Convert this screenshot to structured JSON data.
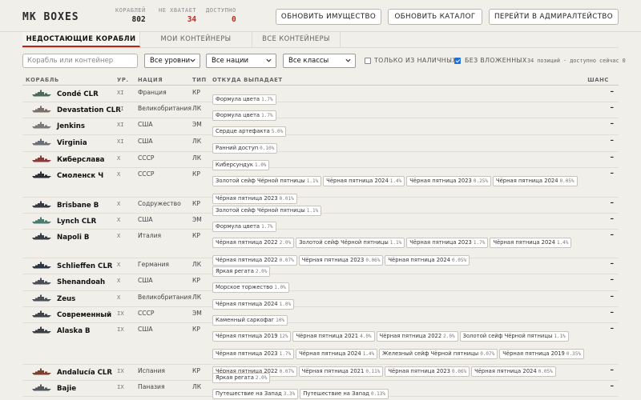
{
  "app": {
    "title": "MK BOXES"
  },
  "stats": [
    {
      "label": "КОРАБЛЕЙ",
      "value": "802",
      "color": "#222222"
    },
    {
      "label": "НЕ ХВАТАЕТ",
      "value": "34",
      "color": "#c0291f"
    },
    {
      "label": "ДОСТУПНО",
      "value": "0",
      "color": "#c0291f"
    }
  ],
  "header_buttons": [
    {
      "label": "ОБНОВИТЬ ИМУЩЕСТВО"
    },
    {
      "label": "ОБНОВИТЬ КАТАЛОГ"
    },
    {
      "label": "ПЕРЕЙТИ В АДМИРАЛТЕЙСТВО"
    }
  ],
  "tabs": [
    {
      "label": "НЕДОСТАЮЩИЕ КОРАБЛИ",
      "active": true
    },
    {
      "label": "МОИ КОНТЕЙНЕРЫ",
      "active": false
    },
    {
      "label": "ВСЕ КОНТЕЙНЕРЫ",
      "active": false
    }
  ],
  "filters": {
    "search_placeholder": "Корабль или контейнер",
    "tier_select": "Все уровни",
    "nation_select": "Все нации",
    "class_select": "Все классы",
    "only_available": {
      "label": "ТОЛЬКО ИЗ НАЛИЧНЫХ",
      "checked": false
    },
    "no_nested": {
      "label": "БЕЗ ВЛОЖЕННЫХ",
      "checked": true
    },
    "count_text": "34 позиций · доступно сейчас 0"
  },
  "table": {
    "headers": {
      "ship": "КОРАБЛЬ",
      "tier": "УР.",
      "nation": "НАЦИЯ",
      "type": "ТИП",
      "source": "ОТКУДА ВЫПАДАЕТ",
      "chance": "ШАНС"
    },
    "rows": [
      {
        "name": "Condé CLR",
        "tier": "XI",
        "nation": "Франция",
        "type": "КР",
        "chance": "–",
        "drops": [
          {
            "name": "Формула цвета",
            "pct": "1.7%"
          }
        ]
      },
      {
        "name": "Devastation CLR",
        "tier": "XI",
        "nation": "Великобритания",
        "type": "ЛК",
        "chance": "–",
        "drops": [
          {
            "name": "Формула цвета",
            "pct": "1.7%"
          }
        ]
      },
      {
        "name": "Jenkins",
        "tier": "XI",
        "nation": "США",
        "type": "ЭМ",
        "chance": "–",
        "drops": [
          {
            "name": "Сердце артефакта",
            "pct": "5.0%"
          }
        ]
      },
      {
        "name": "Virginia",
        "tier": "XI",
        "nation": "США",
        "type": "ЛК",
        "chance": "–",
        "drops": [
          {
            "name": "Ранний доступ",
            "pct": "0.10%"
          }
        ]
      },
      {
        "name": "Киберслава",
        "tier": "X",
        "nation": "СССР",
        "type": "ЛК",
        "chance": "–",
        "drops": [
          {
            "name": "Киберсундук",
            "pct": "1.0%"
          }
        ]
      },
      {
        "name": "Смоленск Ч",
        "tier": "X",
        "nation": "СССР",
        "type": "КР",
        "chance": "–",
        "drops": [
          {
            "name": "Золотой сейф Чёрной пятницы",
            "pct": "1.1%"
          },
          {
            "name": "Чёрная пятница 2024",
            "pct": "1.4%"
          },
          {
            "name": "Чёрная пятница 2023",
            "pct": "0.25%"
          },
          {
            "name": "Чёрная пятница 2024",
            "pct": "0.05%"
          },
          {
            "name": "Чёрная пятница 2023",
            "pct": "0.01%"
          }
        ]
      },
      {
        "name": "Brisbane B",
        "tier": "X",
        "nation": "Содружество",
        "type": "КР",
        "chance": "–",
        "drops": [
          {
            "name": "Золотой сейф Чёрной пятницы",
            "pct": "1.1%"
          }
        ]
      },
      {
        "name": "Lynch CLR",
        "tier": "X",
        "nation": "США",
        "type": "ЭМ",
        "chance": "–",
        "drops": [
          {
            "name": "Формула цвета",
            "pct": "1.7%"
          }
        ]
      },
      {
        "name": "Napoli B",
        "tier": "X",
        "nation": "Италия",
        "type": "КР",
        "chance": "–",
        "drops": [
          {
            "name": "Чёрная пятница 2022",
            "pct": "2.0%"
          },
          {
            "name": "Золотой сейф Чёрной пятницы",
            "pct": "1.1%"
          },
          {
            "name": "Чёрная пятница 2023",
            "pct": "1.7%"
          },
          {
            "name": "Чёрная пятница 2024",
            "pct": "1.4%"
          },
          {
            "name": "Чёрная пятница 2022",
            "pct": "0.07%"
          },
          {
            "name": "Чёрная пятница 2023",
            "pct": "0.06%"
          },
          {
            "name": "Чёрная пятница 2024",
            "pct": "0.05%"
          }
        ]
      },
      {
        "name": "Schlieffen CLR",
        "tier": "X",
        "nation": "Германия",
        "type": "ЛК",
        "chance": "–",
        "drops": [
          {
            "name": "Яркая регата",
            "pct": "2.0%"
          }
        ]
      },
      {
        "name": "Shenandoah",
        "tier": "X",
        "nation": "США",
        "type": "КР",
        "chance": "–",
        "drops": [
          {
            "name": "Морское торжество",
            "pct": "1.0%"
          }
        ]
      },
      {
        "name": "Zeus",
        "tier": "X",
        "nation": "Великобритания",
        "type": "ЛК",
        "chance": "–",
        "drops": [
          {
            "name": "Чёрная пятница 2024",
            "pct": "1.0%"
          }
        ]
      },
      {
        "name": "Современный",
        "tier": "IX",
        "nation": "СССР",
        "type": "ЭМ",
        "chance": "–",
        "drops": [
          {
            "name": "Каменный саркофаг",
            "pct": "10%"
          }
        ]
      },
      {
        "name": "Alaska B",
        "tier": "IX",
        "nation": "США",
        "type": "КР",
        "chance": "–",
        "drops": [
          {
            "name": "Чёрная пятница 2019",
            "pct": "12%"
          },
          {
            "name": "Чёрная пятница 2021",
            "pct": "4.0%"
          },
          {
            "name": "Чёрная пятница 2022",
            "pct": "2.0%"
          },
          {
            "name": "Золотой сейф Чёрной пятницы",
            "pct": "1.1%"
          },
          {
            "name": "Чёрная пятница 2023",
            "pct": "1.7%"
          },
          {
            "name": "Чёрная пятница 2024",
            "pct": "1.4%"
          },
          {
            "name": "Железный сейф Чёрной пятницы",
            "pct": "0.07%"
          },
          {
            "name": "Чёрная пятница 2019",
            "pct": "0.35%"
          },
          {
            "name": "Чёрная пятница 2022",
            "pct": "0.07%"
          },
          {
            "name": "Чёрная пятница 2021",
            "pct": "0.11%"
          },
          {
            "name": "Чёрная пятница 2023",
            "pct": "0.06%"
          },
          {
            "name": "Чёрная пятница 2024",
            "pct": "0.05%"
          }
        ]
      },
      {
        "name": "Andalucía CLR",
        "tier": "IX",
        "nation": "Испания",
        "type": "КР",
        "chance": "–",
        "drops": [
          {
            "name": "Яркая регата",
            "pct": "2.0%"
          }
        ]
      },
      {
        "name": "Bajie",
        "tier": "IX",
        "nation": "Паназия",
        "type": "ЛК",
        "chance": "–",
        "drops": [
          {
            "name": "Путешествие на Запад",
            "pct": "3.3%"
          },
          {
            "name": "Путешествие на Запад",
            "pct": "0.13%"
          }
        ]
      }
    ]
  },
  "colors": {
    "accent": "#b5261e",
    "checkbox": "#1e6fd9",
    "background": "#f1efea"
  }
}
